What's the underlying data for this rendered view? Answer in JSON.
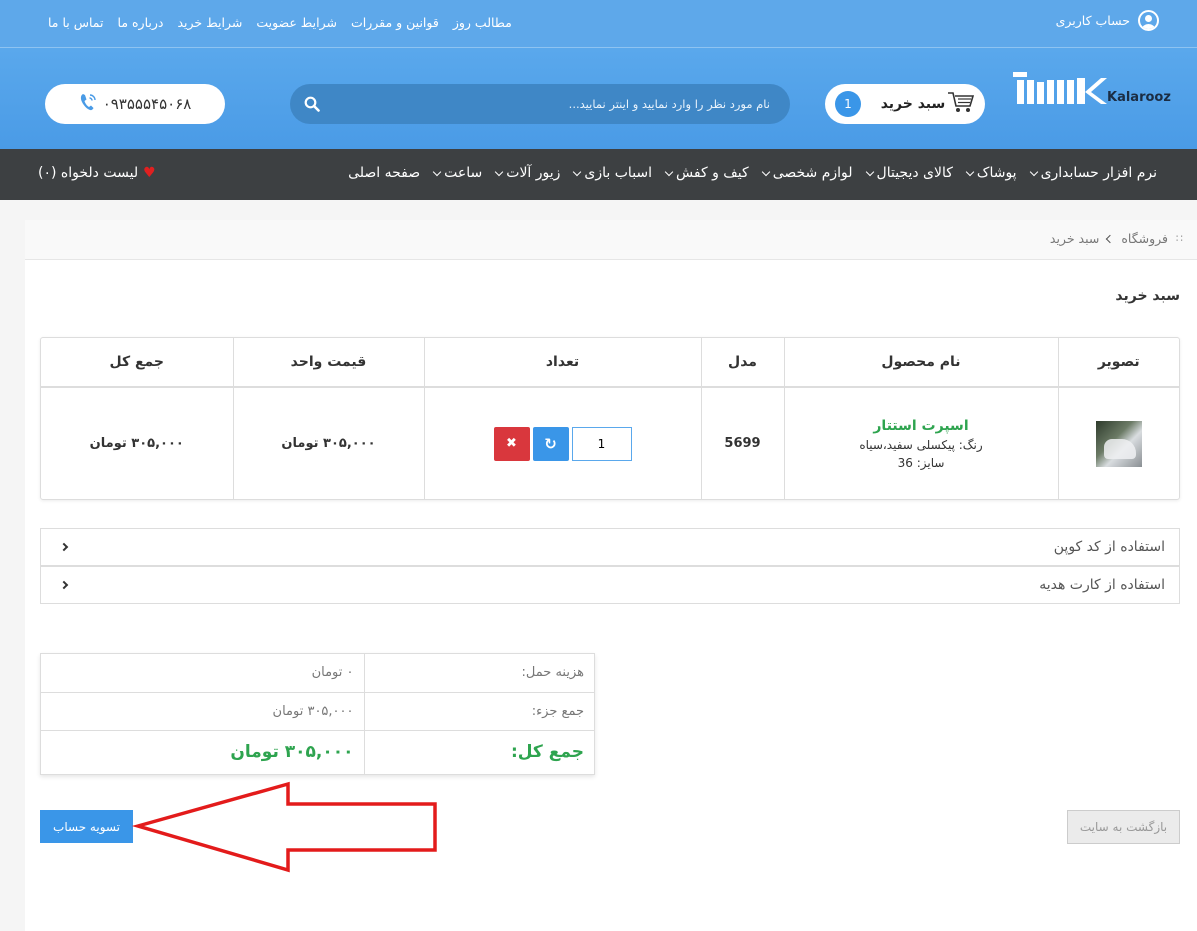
{
  "topbar": {
    "links": [
      "تماس با ما",
      "درباره ما",
      "شرایط خرید",
      "شرایط عضویت",
      "قوانین و مقررات",
      "مطالب روز"
    ],
    "account_label": "حساب کاربری",
    "account_icon": "user-icon"
  },
  "header": {
    "logo_text": "Kalarooz",
    "cart_label": "سبد خرید",
    "cart_count": "1",
    "search_placeholder": "نام مورد نظر را وارد نمایید و اینتر نمایید...",
    "phone": "۰۹۳۵۵۵۴۵۰۶۸"
  },
  "nav": {
    "items": [
      {
        "label": "صفحه اصلی",
        "has_dropdown": false
      },
      {
        "label": "ساعت",
        "has_dropdown": true
      },
      {
        "label": "زیور آلات",
        "has_dropdown": true
      },
      {
        "label": "اسباب بازی",
        "has_dropdown": true
      },
      {
        "label": "کیف و کفش",
        "has_dropdown": true
      },
      {
        "label": "لوازم شخصی",
        "has_dropdown": true
      },
      {
        "label": "کالای دیجیتال",
        "has_dropdown": true
      },
      {
        "label": "پوشاک",
        "has_dropdown": true
      },
      {
        "label": "نرم افزار حسابداری",
        "has_dropdown": true
      }
    ],
    "wishlist_label": "لیست دلخواه (۰)"
  },
  "breadcrumb": {
    "items": [
      "فروشگاه",
      "سبد خرید"
    ]
  },
  "page_title": "سبد خرید",
  "cart_table": {
    "headers": [
      "تصویر",
      "نام محصول",
      "مدل",
      "تعداد",
      "قیمت واحد",
      "جمع کل"
    ],
    "rows": [
      {
        "product_name": "اسپرت استتار",
        "option_color": "رنگ: پیکسلی سفید،سیاه",
        "option_size": "سایز: 36",
        "model": "5699",
        "quantity": "1",
        "unit_price": "۳۰۵,۰۰۰ تومان",
        "total": "۳۰۵,۰۰۰ تومان"
      }
    ]
  },
  "accordion": {
    "coupon": "استفاده از کد کوپن",
    "gift": "استفاده از کارت هدیه"
  },
  "totals": {
    "shipping_label": "هزینه حمل:",
    "shipping_value": "۰ تومان",
    "subtotal_label": "جمع جزء:",
    "subtotal_value": "۳۰۵,۰۰۰ تومان",
    "total_label": "جمع کل:",
    "total_value": "۳۰۵,۰۰۰ تومان"
  },
  "actions": {
    "checkout": "تسویه حساب",
    "back": "بازگشت به سایت"
  },
  "colors": {
    "header_blue": "#5ea8ea",
    "nav_dark": "#3d4042",
    "green": "#2ea44f",
    "annotation_red": "#e31b1b"
  }
}
